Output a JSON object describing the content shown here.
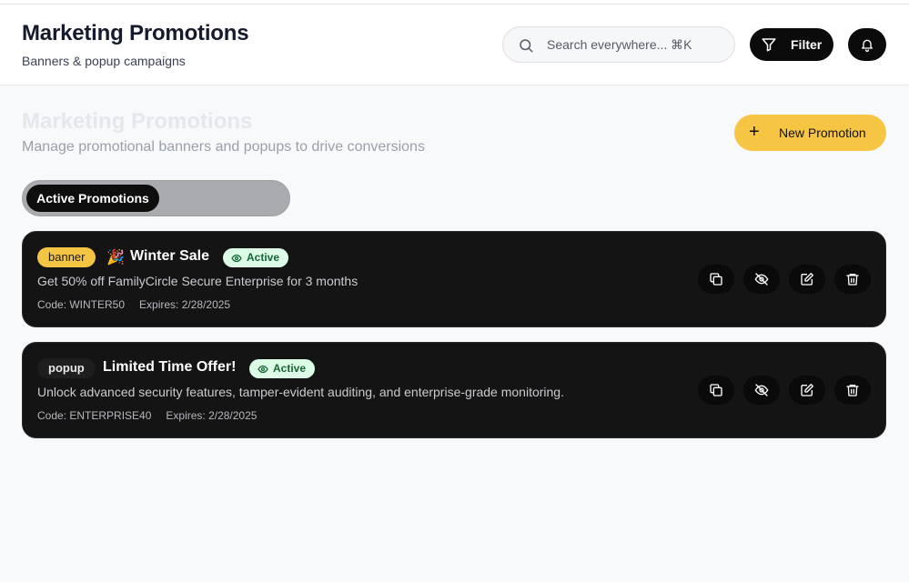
{
  "header": {
    "title": "Marketing Promotions",
    "subtitle": "Banners & popup campaigns",
    "search_placeholder": "Search everywhere... ⌘K",
    "filter_label": "Filter"
  },
  "page": {
    "title": "Marketing Promotions",
    "description": "Manage promotional banners and popups to drive conversions",
    "new_button_label": "New Promotion",
    "new_button_icon": "+"
  },
  "tabs": [
    {
      "label": "Active Promotions",
      "active": true
    }
  ],
  "promotions": [
    {
      "type": "banner",
      "emoji": "🎉",
      "title": "Winter Sale",
      "status": "Active",
      "description": "Get 50% off FamilyCircle Secure Enterprise for 3 months",
      "code": "Code: WINTER50",
      "expires": "Expires: 2/28/2025"
    },
    {
      "type": "popup",
      "emoji": "",
      "title": "Limited Time Offer!",
      "status": "Active",
      "description": "Unlock advanced security features, tamper-evident auditing, and enterprise-grade monitoring.",
      "code": "Code: ENTERPRISE40",
      "expires": "Expires: 2/28/2025"
    }
  ],
  "icons": {
    "search": "search-icon",
    "filter": "filter-icon",
    "bell": "bell-icon",
    "status": "eye-icon",
    "actions": [
      "copy-icon",
      "eye-off-icon",
      "edit-icon",
      "trash-icon"
    ]
  },
  "colors": {
    "accent": "#f6c543",
    "card_bg": "#141414",
    "status_bg": "#dcfce7",
    "status_text": "#166534"
  }
}
